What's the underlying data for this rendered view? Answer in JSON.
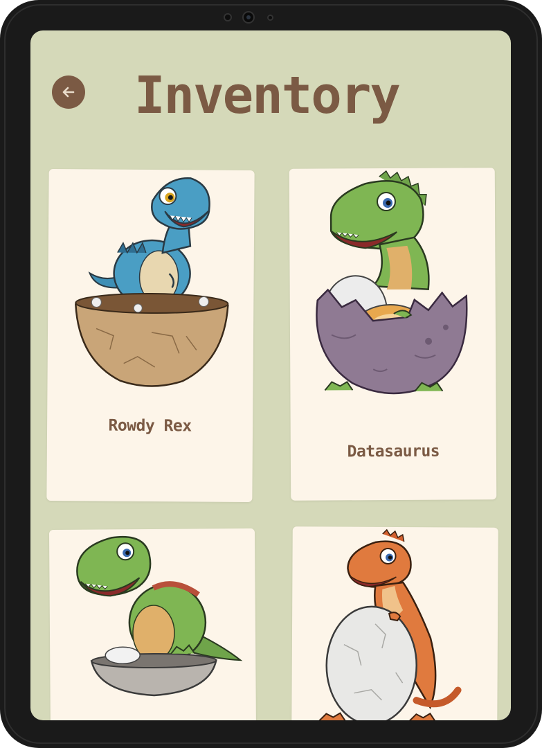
{
  "header": {
    "title": "Inventory",
    "back_icon": "arrow-left-icon"
  },
  "colors": {
    "screen_bg": "#d5d9b9",
    "card_bg": "#fdf5e9",
    "accent_brown": "#7b5a44"
  },
  "inventory": {
    "items": [
      {
        "name": "Rowdy Rex",
        "art": "blue-dinosaur-in-brown-nest-icon"
      },
      {
        "name": "Datasaurus",
        "art": "green-trex-in-purple-egg-icon"
      },
      {
        "name": "",
        "art": "green-trex-in-grey-egg-shell-icon"
      },
      {
        "name": "",
        "art": "orange-dinosaur-holding-egg-icon"
      }
    ]
  }
}
